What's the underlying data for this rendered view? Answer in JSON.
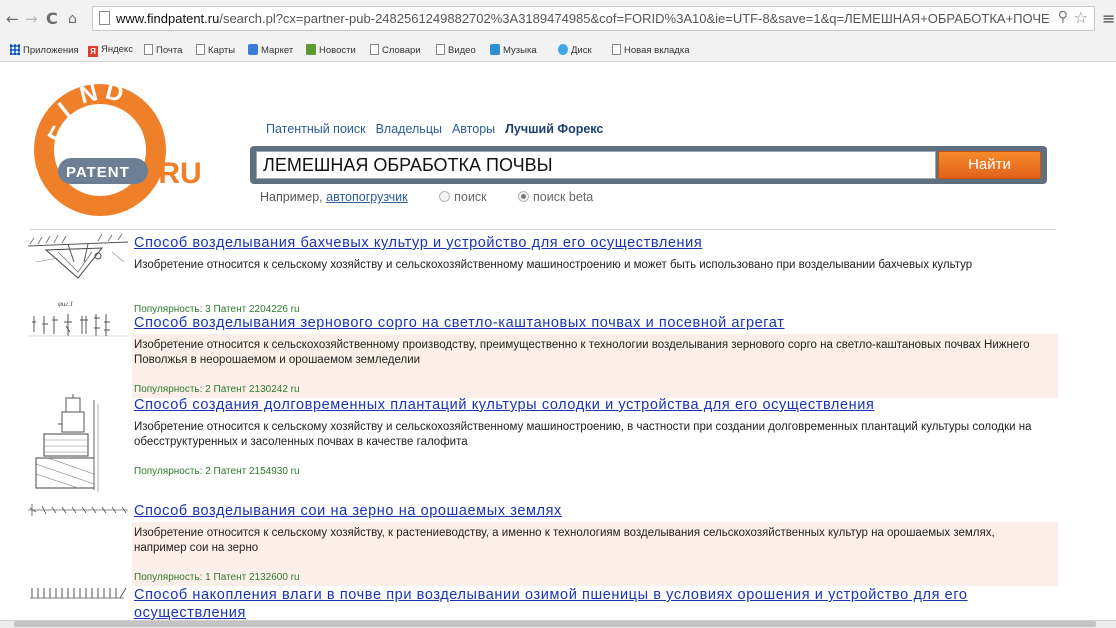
{
  "browser": {
    "url_host": "www.findpatent.ru",
    "url_rest": "/search.pl?cx=partner-pub-2482561249882702%3A3189474985&cof=FORID%3A10&ie=UTF-8&save=1&q=ЛЕМЕШНАЯ+ОБРАБОТКА+ПОЧЕ",
    "bookmarks": [
      "Приложения",
      "Яндекс",
      "Почта",
      "Карты",
      "Маркет",
      "Новости",
      "Словари",
      "Видео",
      "Музыка",
      "Диск",
      "Новая вкладка"
    ]
  },
  "site": {
    "logo_find": "FIND",
    "logo_patent": "PATENT",
    "logo_ru": ".RU",
    "nav": {
      "patent_search": "Патентный поиск",
      "owners": "Владельцы",
      "authors": "Авторы",
      "best_forex": "Лучший Форекс"
    },
    "search": {
      "query": "ЛЕМЕШНАЯ ОБРАБОТКА ПОЧВЫ",
      "button": "Найти",
      "example_prefix": "Например,",
      "example_link": "автопогрузчик",
      "option_search": "поиск",
      "option_search_beta": "поиск beta"
    }
  },
  "results": [
    {
      "title": "Способ возделывания бахчевых культур и устройство для его осуществления",
      "description": "Изобретение относится к сельскому хозяйству и сельскохозяйственному машиностроению и может быть использовано при возделывании бахчевых культур",
      "meta": "Популярность: 3 Патент 2204226 ru"
    },
    {
      "title": "Способ возделывания зернового сорго на светло-каштановых почвах и посевной агрегат",
      "description": "Изобретение относится к сельскохозяйственному производству, преимущественно к технологии возделывания зернового сорго на светло-каштановых почвах Нижнего Поволжья в неорошаемом и орошаемом земледелии",
      "meta": "Популярность: 2 Патент 2130242 ru"
    },
    {
      "title": "Способ создания долговременных плантаций культуры солодки и устройства для его осуществления",
      "description": "Изобретение относится к сельскому хозяйству и сельскохозяйственному машиностроению, в частности при создании долговременных плантаций культуры солодки на обесструктуренных и засоленных почвах в качестве галофита",
      "meta": "Популярность: 2 Патент 2154930 ru"
    },
    {
      "title": "Способ возделывания сои на зерно на орошаемых землях",
      "description": "Изобретение относится к сельскому хозяйству, к растениеводству, а именно к технологиям возделывания сельскохозяйственных культур на орошаемых землях, например сои на зерно",
      "meta": "Популярность: 1 Патент 2132600 ru"
    },
    {
      "title": "Способ накопления влаги в почве при возделывании озимой пшеницы в условиях орошения и устройство для его",
      "title_cont": "осуществления"
    }
  ]
}
